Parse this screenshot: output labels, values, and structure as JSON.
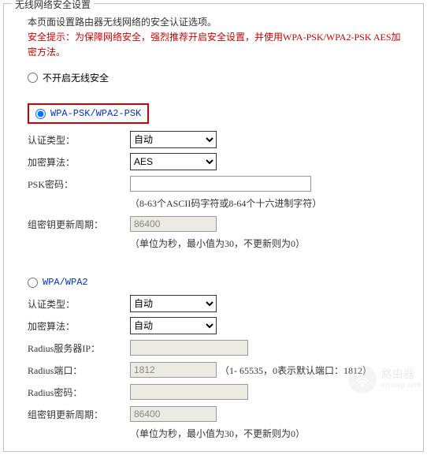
{
  "panel": {
    "title": "无线网络安全设置"
  },
  "intro": "本页面设置路由器无线网络的安全认证选项。",
  "warning": "安全提示：为保障网络安全，强烈推荐开启安全设置，并使用WPA-PSK/WPA2-PSK AES加密方法。",
  "options": {
    "none": "不开启无线安全",
    "wpapsk": "WPA-PSK/WPA2-PSK",
    "wpa": "WPA/WPA2"
  },
  "labels": {
    "auth_type": "认证类型：",
    "algo": "加密算法：",
    "psk": "PSK密码：",
    "group_key": "组密钥更新周期：",
    "radius_ip": "Radius服务器IP：",
    "radius_port": "Radius端口：",
    "radius_pw": "Radius密码："
  },
  "select_values": {
    "auth_auto": "自动",
    "algo_aes": "AES",
    "algo_auto": "自动"
  },
  "inputs": {
    "psk_value": "",
    "group_key_1": "86400",
    "radius_ip": "",
    "radius_port": "1812",
    "radius_pw": "",
    "group_key_2": "86400"
  },
  "hints": {
    "psk": "（8-63个ASCII码字符或8-64个十六进制字符）",
    "group_key": "（单位为秒，最小值为30，不更新则为0）",
    "radius_port": "（1- 65535，0表示默认端口：1812）"
  },
  "watermark": {
    "name": "路由器",
    "url": "luyouqi.com"
  }
}
